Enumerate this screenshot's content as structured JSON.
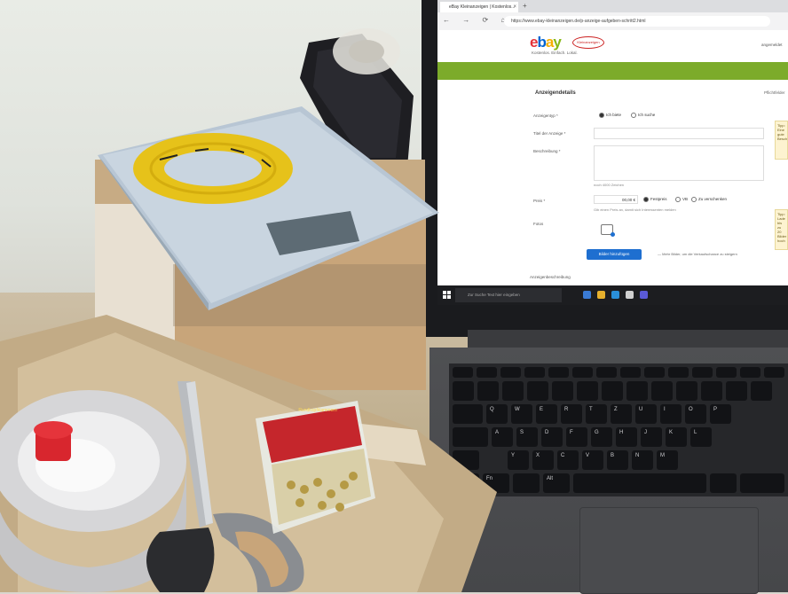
{
  "browser": {
    "tab_title": "eBay Kleinanzeigen | Kostenlos...",
    "tab_close": "×",
    "tab_new": "+",
    "nav_icons": "← → ⟳ ⌂",
    "url": "https://www.ebay-kleinanzeigen.de/p-anzeige-aufgeben-schritt2.html"
  },
  "site": {
    "logo_e": "e",
    "logo_b": "b",
    "logo_a": "a",
    "logo_y": "y",
    "logo_badge": "Kleinanzeigen",
    "tagline": "Kostenlos. Einfach. Lokal.",
    "header_right": "angemeldet",
    "colors": {
      "green_bar": "#7cab2a",
      "upload_button": "#1e6fd0",
      "logo_red": "#e53238",
      "logo_blue": "#0064d2",
      "logo_yellow": "#f5af02",
      "logo_green": "#86b817"
    }
  },
  "form": {
    "title": "Anzeigendetails",
    "right_hint": "Pflichtfelder",
    "labels": {
      "ad_type": "Anzeigentyp *",
      "ad_title": "Titel der Anzeige *",
      "description": "Beschreibung *",
      "price": "Preis *",
      "photos": "Fotos"
    },
    "radios": {
      "offer": "Ich biete",
      "search": "Ich suche",
      "fixed": "Festpreis",
      "vb": "VB",
      "give_away": "Zu verschenken"
    },
    "notes": {
      "description": "noch 4000 Zeichen",
      "price": "Gib einen Preis an, damit sich Interessenten melden"
    },
    "price_value": "00,00 €",
    "upload_button": "Bilder hinzufügen",
    "upload_hint": "— Mehr Bilder, um die Verkaufschance zu steigern",
    "bottom_label": "Anzeigenbeschreibung",
    "tip_1": "Tipp: Eine gute Beschreibung",
    "tip_2": "Tipp: Lade bis zu 20 Bilder hoch"
  },
  "taskbar": {
    "search_placeholder": "Zur Suche Text hier eingeben"
  },
  "keyboard": {
    "row_letters": [
      "Q",
      "W",
      "E",
      "R",
      "T",
      "Z",
      "U",
      "I",
      "O",
      "P"
    ],
    "row_home": [
      "A",
      "S",
      "D",
      "F",
      "G",
      "H",
      "J",
      "K",
      "L"
    ],
    "row_bottom": [
      "Y",
      "X",
      "C",
      "V",
      "B",
      "N",
      "M"
    ],
    "fn_label": "Fn",
    "alt_label": "Alt",
    "strg_label": "Strg"
  },
  "brads": {
    "label": "Rundkopfklammern"
  }
}
